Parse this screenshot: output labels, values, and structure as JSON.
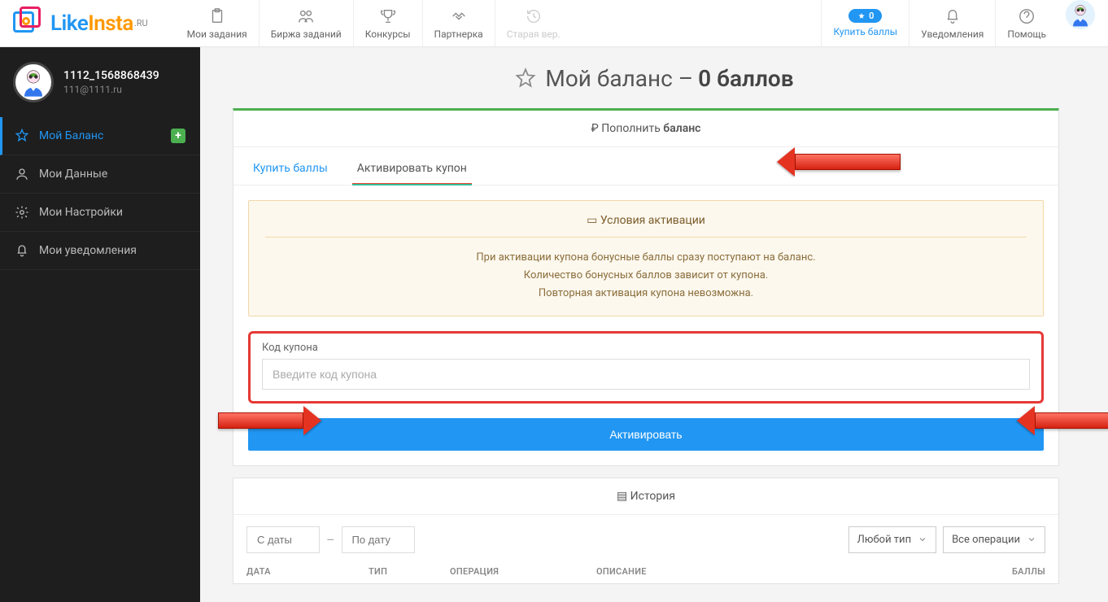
{
  "logo": {
    "text1": "Like",
    "text2": "Insta",
    "suffix": ".RU"
  },
  "topnav": [
    {
      "label": "Мои задания"
    },
    {
      "label": "Биржа заданий"
    },
    {
      "label": "Конкурсы"
    },
    {
      "label": "Партнерка"
    },
    {
      "label": "Старая вер."
    }
  ],
  "topright": {
    "buy": "Купить баллы",
    "buy_badge": "0",
    "notif": "Уведомления",
    "help": "Помощь"
  },
  "profile": {
    "name": "1112_1568868439",
    "email": "111@1111.ru"
  },
  "sidebar": [
    {
      "label": "Мой Баланс"
    },
    {
      "label": "Мои Данные"
    },
    {
      "label": "Мои Настройки"
    },
    {
      "label": "Мои уведомления"
    }
  ],
  "page": {
    "title_prefix": "Мой баланс –",
    "title_balance": "0 баллов",
    "topcard_prefix": "Пополнить",
    "topcard_bold": "баланс"
  },
  "tabs": {
    "buy": "Купить баллы",
    "activate": "Активировать купон"
  },
  "alert": {
    "title": "Условия активации",
    "l1": "При активации купона бонусные баллы сразу поступают на баланс.",
    "l2": "Количество бонусных баллов зависит от купона.",
    "l3": "Повторная активация купона невозможна."
  },
  "form": {
    "label": "Код купона",
    "placeholder": "Введите код купона",
    "submit": "Активировать"
  },
  "history": {
    "title": "История",
    "from": "С даты",
    "sep": "–",
    "to": "По дату",
    "type": "Любой тип",
    "ops": "Все операции",
    "cols": {
      "date": "ДАТА",
      "type": "ТИП",
      "op": "ОПЕРАЦИЯ",
      "desc": "ОПИСАНИЕ",
      "pts": "БАЛЛЫ"
    }
  }
}
